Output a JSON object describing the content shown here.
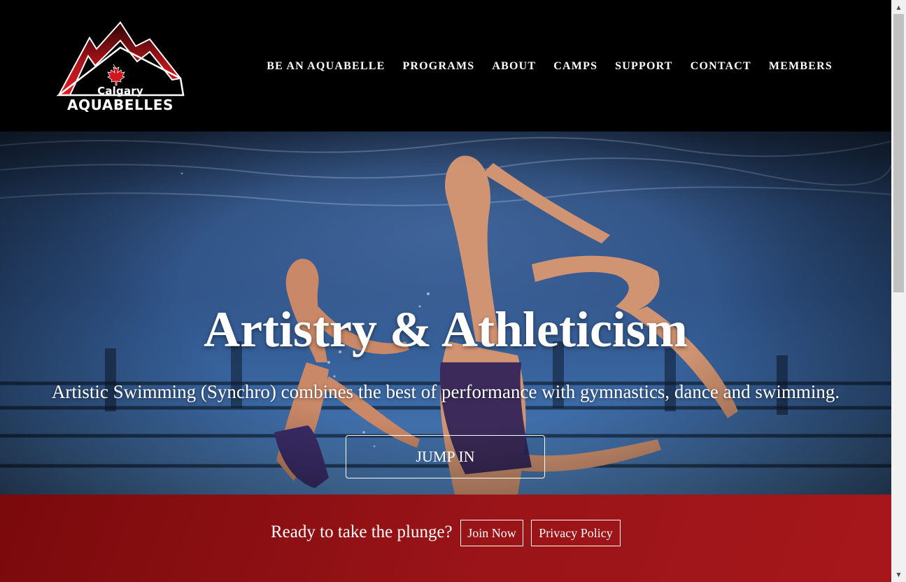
{
  "logo": {
    "line1": "Calgary",
    "line2": "AQUABELLES",
    "colors": {
      "mountain": "#c8161d",
      "maple": "#d4141c",
      "outline": "#ffffff"
    }
  },
  "nav": {
    "items": [
      {
        "label": "BE AN AQUABELLE"
      },
      {
        "label": "PROGRAMS"
      },
      {
        "label": "ABOUT"
      },
      {
        "label": "CAMPS"
      },
      {
        "label": "SUPPORT"
      },
      {
        "label": "CONTACT"
      },
      {
        "label": "MEMBERS"
      }
    ]
  },
  "hero": {
    "title": "Artistry & Athleticism",
    "subtitle": "Artistic Swimming (Synchro) combines the best of performance with gymnastics, dance and swimming.",
    "button_label": "JUMP IN",
    "image_icon": "underwater-swimmers-photo"
  },
  "cta": {
    "text": "Ready to take the plunge?",
    "join_label": "Join Now",
    "privacy_label": "Privacy Policy",
    "background_color": "#9a1418"
  },
  "scrollbar": {
    "up_icon": "triangle-up-icon",
    "down_icon": "triangle-down-icon"
  }
}
